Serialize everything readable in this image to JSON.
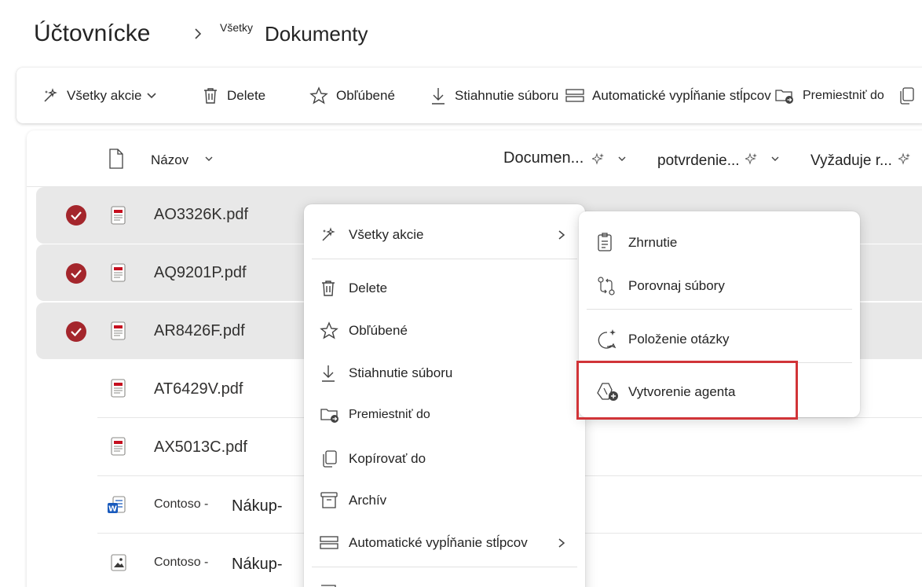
{
  "header": {
    "title": "Účtovnícke",
    "breadcrumb_small": "Všetky",
    "breadcrumb_current": "Dokumenty"
  },
  "toolbar": {
    "all_actions": "Všetky akcie",
    "delete": "Delete",
    "favorite": "Obľúbené",
    "download": "Stiahnutie súboru",
    "autofill": "Automatické vypĺňanie stĺpcov",
    "move_to": "Premiestniť do"
  },
  "columns": {
    "name": "Názov",
    "document": "Documen...",
    "confirmation": "potvrdenie...",
    "requires": "Vyžaduje r..."
  },
  "files": [
    {
      "name": "AO3326K.pdf",
      "selected": true,
      "icon": "pdf-file-icon"
    },
    {
      "name": "AQ9201P.pdf",
      "selected": true,
      "icon": "pdf-file-icon"
    },
    {
      "name": "AR8426F.pdf",
      "selected": true,
      "icon": "pdf-file-icon"
    },
    {
      "name": "AT6429V.pdf",
      "selected": false,
      "icon": "pdf-file-icon"
    },
    {
      "name": "AX5013C.pdf",
      "selected": false,
      "icon": "pdf-file-icon"
    },
    {
      "name_prefix": "Contoso -",
      "name_suffix": "Nákup-",
      "selected": false,
      "icon": "word-file-icon"
    },
    {
      "name_prefix": "Contoso -",
      "name_suffix": "Nákup-",
      "selected": false,
      "icon": "image-file-icon"
    }
  ],
  "context_menu": {
    "all_actions": "Všetky akcie",
    "delete": "Delete",
    "favorite": "Obľúbené",
    "download": "Stiahnutie súboru",
    "move_to": "Premiestniť do",
    "copy_to": "Kopírovať do",
    "archive": "Archív",
    "autofill": "Automatické vypĺňanie stĺpcov"
  },
  "submenu": {
    "summary": "Zhrnutie",
    "compare": "Porovnaj súbory",
    "ask": "Položenie otázky",
    "create_agent": "Vytvorenie agenta"
  },
  "colors": {
    "check_red": "#a4262c",
    "highlight_red": "#d13438",
    "selected_row": "#e8e8e8"
  }
}
